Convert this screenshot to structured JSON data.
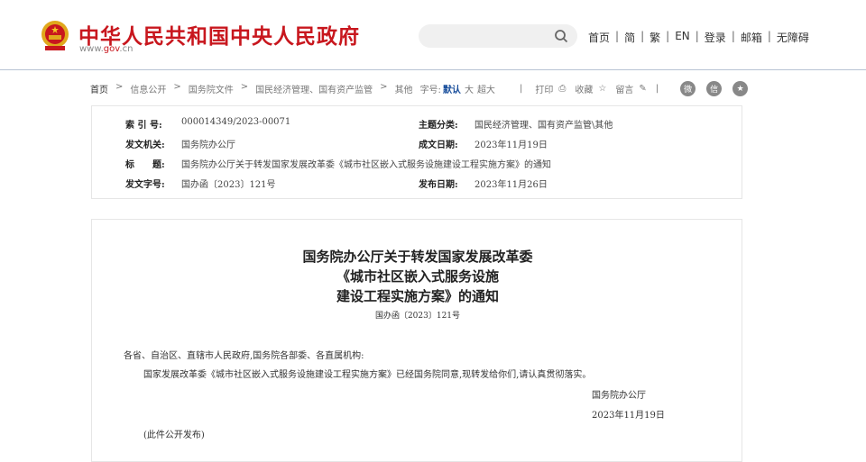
{
  "header": {
    "site_title": "中华人民共和国中央人民政府",
    "url_prefix": "www.",
    "url_gov": "gov",
    "url_suffix": ".cn",
    "search_placeholder": "",
    "nav": [
      "首页",
      "简",
      "繁",
      "EN",
      "登录",
      "邮箱",
      "无障碍"
    ]
  },
  "breadcrumb": {
    "items": [
      "首页",
      ">",
      "信息公开",
      ">",
      "国务院文件",
      ">",
      "国民经济管理、国有资产监管",
      ">",
      "其他"
    ],
    "font_label": "字号:",
    "font_default": "默认",
    "font_large": "大",
    "font_xlarge": "超大"
  },
  "tools": {
    "sep": "|",
    "print": "打印",
    "favorite": "收藏",
    "comment": "留言",
    "sep2": "|"
  },
  "info": {
    "index_label": "索 引 号:",
    "index": "000014349/2023-00071",
    "topic_label": "主题分类:",
    "topic": "国民经济管理、国有资产监管\\其他",
    "issuer_label": "发文机关:",
    "issuer": "国务院办公厅",
    "written_label": "成文日期:",
    "written": "2023年11月19日",
    "title_label": "标　　题:",
    "title": "国务院办公厅关于转发国家发展改革委《城市社区嵌入式服务设施建设工程实施方案》的通知",
    "docno_label": "发文字号:",
    "docno": "国办函〔2023〕121号",
    "pub_label": "发布日期:",
    "pub": "2023年11月26日"
  },
  "article": {
    "title_lines": [
      "国务院办公厅关于转发国家发展改革委",
      "《城市社区嵌入式服务设施",
      "建设工程实施方案》的通知"
    ],
    "docno": "国办函〔2023〕121号",
    "salutation": "各省、自治区、直辖市人民政府,国务院各部委、各直属机构:",
    "body": "国家发展改革委《城市社区嵌入式服务设施建设工程实施方案》已经国务院同意,现转发给你们,请认真贯彻落实。",
    "signer": "国务院办公厅",
    "date": "2023年11月19日",
    "note": "(此件公开发布)"
  }
}
